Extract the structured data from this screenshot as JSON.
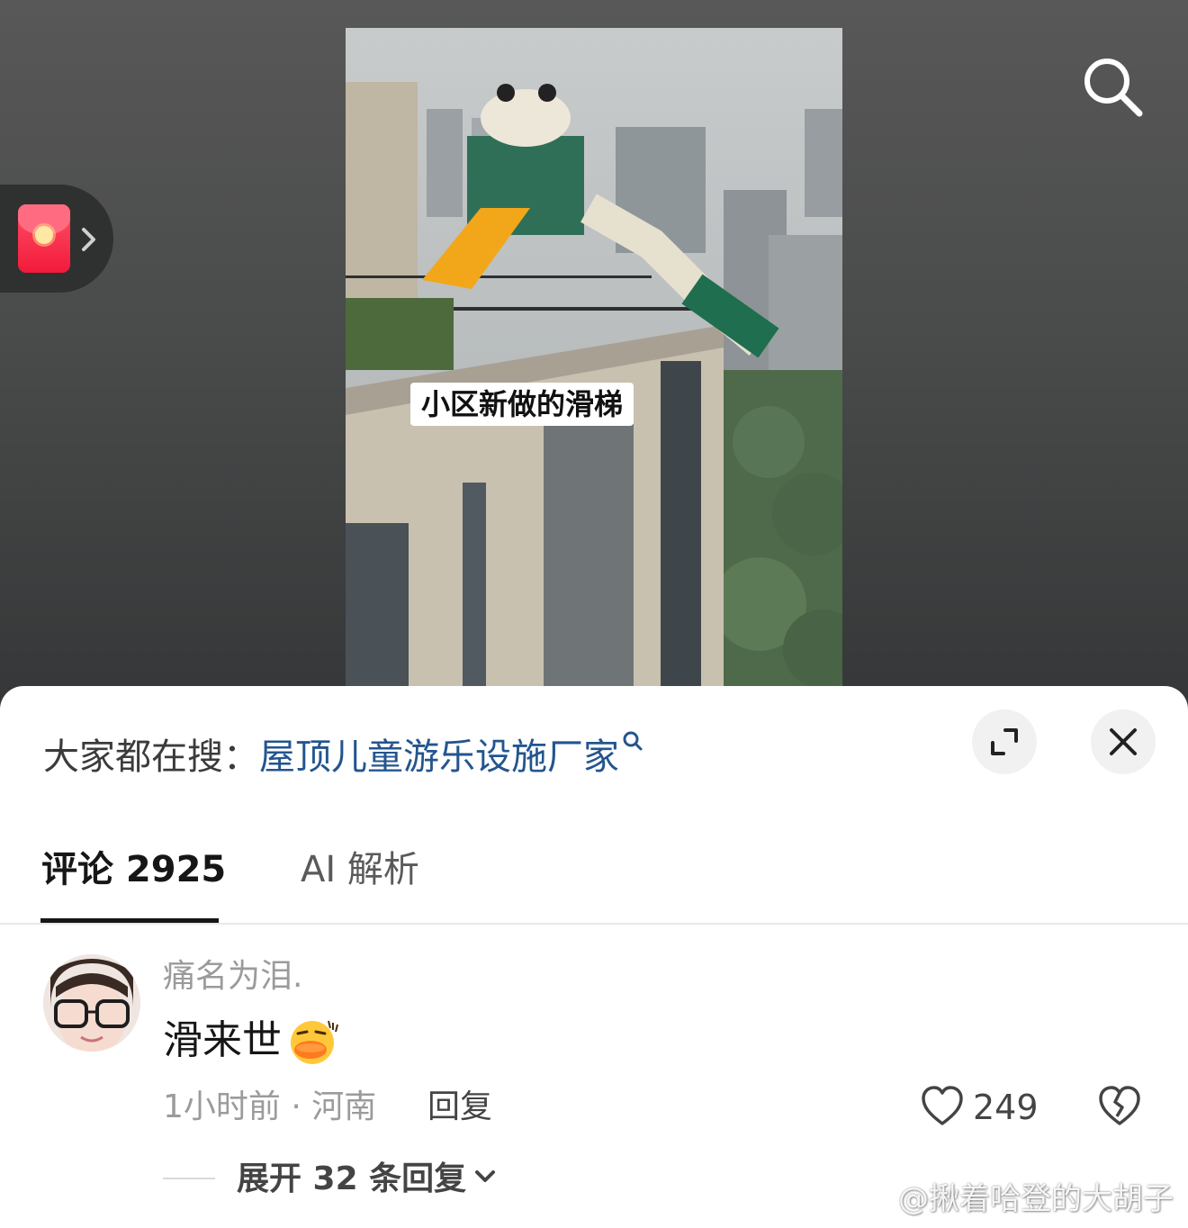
{
  "video": {
    "caption": "小区新做的滑梯"
  },
  "top_bar": {
    "search_icon": "search-icon",
    "red_packet_icon": "red-packet-icon"
  },
  "sheet": {
    "hot_search_prefix": "大家都在搜：",
    "hot_search_keyword": "屋顶儿童游乐设施厂家",
    "expand_icon": "expand-icon",
    "close_icon": "close-icon"
  },
  "tabs": [
    {
      "label": "评论 2925",
      "selected": true
    },
    {
      "label": "AI 解析",
      "selected": false
    }
  ],
  "comment": {
    "username": "痛名为泪.",
    "text": "滑来世",
    "emoji": "duck-kiss-emoji",
    "time_location": "1小时前 · 河南",
    "reply_label": "回复",
    "like_count": "249",
    "expand_replies_label": "展开 32 条回复"
  },
  "watermark": {
    "text": "@揪着哈登的大胡子"
  },
  "colors": {
    "keyword_link": "#23558f",
    "tab_active": "#161616",
    "muted_text": "#9b9b9b",
    "red_packet": "#f21a3a"
  }
}
